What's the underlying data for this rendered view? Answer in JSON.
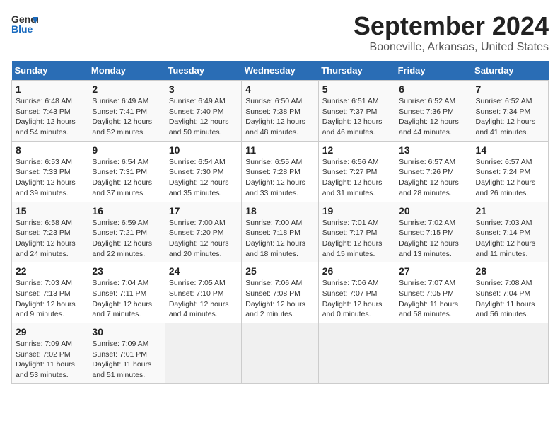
{
  "app": {
    "logo_line1": "General",
    "logo_line2": "Blue"
  },
  "title": "September 2024",
  "subtitle": "Booneville, Arkansas, United States",
  "days_of_week": [
    "Sunday",
    "Monday",
    "Tuesday",
    "Wednesday",
    "Thursday",
    "Friday",
    "Saturday"
  ],
  "weeks": [
    [
      {
        "num": "1",
        "info": "Sunrise: 6:48 AM\nSunset: 7:43 PM\nDaylight: 12 hours\nand 54 minutes."
      },
      {
        "num": "2",
        "info": "Sunrise: 6:49 AM\nSunset: 7:41 PM\nDaylight: 12 hours\nand 52 minutes."
      },
      {
        "num": "3",
        "info": "Sunrise: 6:49 AM\nSunset: 7:40 PM\nDaylight: 12 hours\nand 50 minutes."
      },
      {
        "num": "4",
        "info": "Sunrise: 6:50 AM\nSunset: 7:38 PM\nDaylight: 12 hours\nand 48 minutes."
      },
      {
        "num": "5",
        "info": "Sunrise: 6:51 AM\nSunset: 7:37 PM\nDaylight: 12 hours\nand 46 minutes."
      },
      {
        "num": "6",
        "info": "Sunrise: 6:52 AM\nSunset: 7:36 PM\nDaylight: 12 hours\nand 44 minutes."
      },
      {
        "num": "7",
        "info": "Sunrise: 6:52 AM\nSunset: 7:34 PM\nDaylight: 12 hours\nand 41 minutes."
      }
    ],
    [
      {
        "num": "8",
        "info": "Sunrise: 6:53 AM\nSunset: 7:33 PM\nDaylight: 12 hours\nand 39 minutes."
      },
      {
        "num": "9",
        "info": "Sunrise: 6:54 AM\nSunset: 7:31 PM\nDaylight: 12 hours\nand 37 minutes."
      },
      {
        "num": "10",
        "info": "Sunrise: 6:54 AM\nSunset: 7:30 PM\nDaylight: 12 hours\nand 35 minutes."
      },
      {
        "num": "11",
        "info": "Sunrise: 6:55 AM\nSunset: 7:28 PM\nDaylight: 12 hours\nand 33 minutes."
      },
      {
        "num": "12",
        "info": "Sunrise: 6:56 AM\nSunset: 7:27 PM\nDaylight: 12 hours\nand 31 minutes."
      },
      {
        "num": "13",
        "info": "Sunrise: 6:57 AM\nSunset: 7:26 PM\nDaylight: 12 hours\nand 28 minutes."
      },
      {
        "num": "14",
        "info": "Sunrise: 6:57 AM\nSunset: 7:24 PM\nDaylight: 12 hours\nand 26 minutes."
      }
    ],
    [
      {
        "num": "15",
        "info": "Sunrise: 6:58 AM\nSunset: 7:23 PM\nDaylight: 12 hours\nand 24 minutes."
      },
      {
        "num": "16",
        "info": "Sunrise: 6:59 AM\nSunset: 7:21 PM\nDaylight: 12 hours\nand 22 minutes."
      },
      {
        "num": "17",
        "info": "Sunrise: 7:00 AM\nSunset: 7:20 PM\nDaylight: 12 hours\nand 20 minutes."
      },
      {
        "num": "18",
        "info": "Sunrise: 7:00 AM\nSunset: 7:18 PM\nDaylight: 12 hours\nand 18 minutes."
      },
      {
        "num": "19",
        "info": "Sunrise: 7:01 AM\nSunset: 7:17 PM\nDaylight: 12 hours\nand 15 minutes."
      },
      {
        "num": "20",
        "info": "Sunrise: 7:02 AM\nSunset: 7:15 PM\nDaylight: 12 hours\nand 13 minutes."
      },
      {
        "num": "21",
        "info": "Sunrise: 7:03 AM\nSunset: 7:14 PM\nDaylight: 12 hours\nand 11 minutes."
      }
    ],
    [
      {
        "num": "22",
        "info": "Sunrise: 7:03 AM\nSunset: 7:13 PM\nDaylight: 12 hours\nand 9 minutes."
      },
      {
        "num": "23",
        "info": "Sunrise: 7:04 AM\nSunset: 7:11 PM\nDaylight: 12 hours\nand 7 minutes."
      },
      {
        "num": "24",
        "info": "Sunrise: 7:05 AM\nSunset: 7:10 PM\nDaylight: 12 hours\nand 4 minutes."
      },
      {
        "num": "25",
        "info": "Sunrise: 7:06 AM\nSunset: 7:08 PM\nDaylight: 12 hours\nand 2 minutes."
      },
      {
        "num": "26",
        "info": "Sunrise: 7:06 AM\nSunset: 7:07 PM\nDaylight: 12 hours\nand 0 minutes."
      },
      {
        "num": "27",
        "info": "Sunrise: 7:07 AM\nSunset: 7:05 PM\nDaylight: 11 hours\nand 58 minutes."
      },
      {
        "num": "28",
        "info": "Sunrise: 7:08 AM\nSunset: 7:04 PM\nDaylight: 11 hours\nand 56 minutes."
      }
    ],
    [
      {
        "num": "29",
        "info": "Sunrise: 7:09 AM\nSunset: 7:02 PM\nDaylight: 11 hours\nand 53 minutes."
      },
      {
        "num": "30",
        "info": "Sunrise: 7:09 AM\nSunset: 7:01 PM\nDaylight: 11 hours\nand 51 minutes."
      },
      {
        "num": "",
        "info": ""
      },
      {
        "num": "",
        "info": ""
      },
      {
        "num": "",
        "info": ""
      },
      {
        "num": "",
        "info": ""
      },
      {
        "num": "",
        "info": ""
      }
    ]
  ]
}
